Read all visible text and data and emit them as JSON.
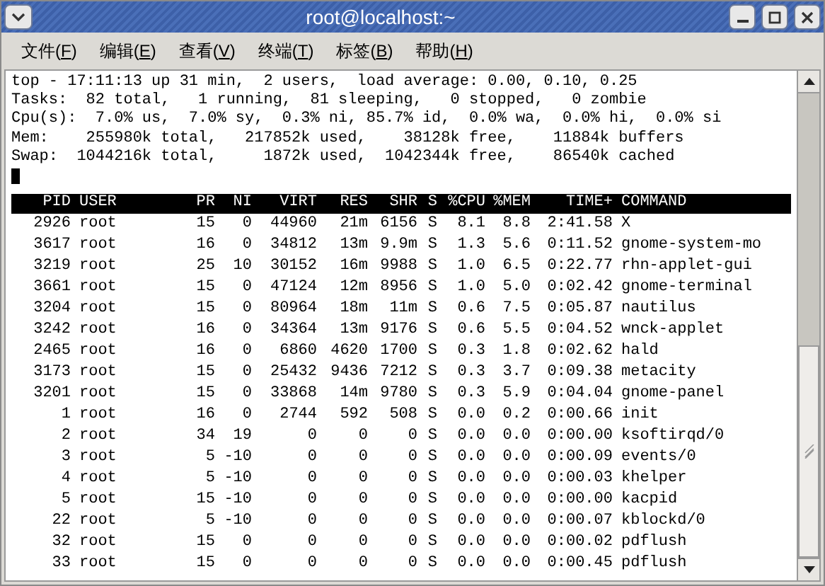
{
  "window": {
    "title": "root@localhost:~"
  },
  "menu": [
    "文件(F)",
    "编辑(E)",
    "查看(V)",
    "终端(T)",
    "标签(B)",
    "帮助(H)"
  ],
  "summary": [
    "top - 17:11:13 up 31 min,  2 users,  load average: 0.00, 0.10, 0.25",
    "Tasks:  82 total,   1 running,  81 sleeping,   0 stopped,   0 zombie",
    "Cpu(s):  7.0% us,  7.0% sy,  0.3% ni, 85.7% id,  0.0% wa,  0.0% hi,  0.0% si",
    "Mem:    255980k total,   217852k used,    38128k free,    11884k buffers",
    "Swap:  1044216k total,     1872k used,  1042344k free,    86540k cached"
  ],
  "table": {
    "columns": [
      "PID",
      "USER",
      "PR",
      "NI",
      "VIRT",
      "RES",
      "SHR",
      "S",
      "%CPU",
      "%MEM",
      "TIME+",
      "COMMAND"
    ],
    "rows": [
      [
        "2926",
        "root",
        "15",
        "0",
        "44960",
        "21m",
        "6156",
        "S",
        "8.1",
        "8.8",
        "2:41.58",
        "X"
      ],
      [
        "3617",
        "root",
        "16",
        "0",
        "34812",
        "13m",
        "9.9m",
        "S",
        "1.3",
        "5.6",
        "0:11.52",
        "gnome-system-mo"
      ],
      [
        "3219",
        "root",
        "25",
        "10",
        "30152",
        "16m",
        "9988",
        "S",
        "1.0",
        "6.5",
        "0:22.77",
        "rhn-applet-gui"
      ],
      [
        "3661",
        "root",
        "15",
        "0",
        "47124",
        "12m",
        "8956",
        "S",
        "1.0",
        "5.0",
        "0:02.42",
        "gnome-terminal"
      ],
      [
        "3204",
        "root",
        "15",
        "0",
        "80964",
        "18m",
        "11m",
        "S",
        "0.6",
        "7.5",
        "0:05.87",
        "nautilus"
      ],
      [
        "3242",
        "root",
        "16",
        "0",
        "34364",
        "13m",
        "9176",
        "S",
        "0.6",
        "5.5",
        "0:04.52",
        "wnck-applet"
      ],
      [
        "2465",
        "root",
        "16",
        "0",
        "6860",
        "4620",
        "1700",
        "S",
        "0.3",
        "1.8",
        "0:02.62",
        "hald"
      ],
      [
        "3173",
        "root",
        "15",
        "0",
        "25432",
        "9436",
        "7212",
        "S",
        "0.3",
        "3.7",
        "0:09.38",
        "metacity"
      ],
      [
        "3201",
        "root",
        "15",
        "0",
        "33868",
        "14m",
        "9780",
        "S",
        "0.3",
        "5.9",
        "0:04.04",
        "gnome-panel"
      ],
      [
        "1",
        "root",
        "16",
        "0",
        "2744",
        "592",
        "508",
        "S",
        "0.0",
        "0.2",
        "0:00.66",
        "init"
      ],
      [
        "2",
        "root",
        "34",
        "19",
        "0",
        "0",
        "0",
        "S",
        "0.0",
        "0.0",
        "0:00.00",
        "ksoftirqd/0"
      ],
      [
        "3",
        "root",
        "5",
        "-10",
        "0",
        "0",
        "0",
        "S",
        "0.0",
        "0.0",
        "0:00.09",
        "events/0"
      ],
      [
        "4",
        "root",
        "5",
        "-10",
        "0",
        "0",
        "0",
        "S",
        "0.0",
        "0.0",
        "0:00.03",
        "khelper"
      ],
      [
        "5",
        "root",
        "15",
        "-10",
        "0",
        "0",
        "0",
        "S",
        "0.0",
        "0.0",
        "0:00.00",
        "kacpid"
      ],
      [
        "22",
        "root",
        "5",
        "-10",
        "0",
        "0",
        "0",
        "S",
        "0.0",
        "0.0",
        "0:00.07",
        "kblockd/0"
      ],
      [
        "32",
        "root",
        "15",
        "0",
        "0",
        "0",
        "0",
        "S",
        "0.0",
        "0.0",
        "0:00.02",
        "pdflush"
      ],
      [
        "33",
        "root",
        "15",
        "0",
        "0",
        "0",
        "0",
        "S",
        "0.0",
        "0.0",
        "0:00.45",
        "pdflush"
      ]
    ]
  }
}
